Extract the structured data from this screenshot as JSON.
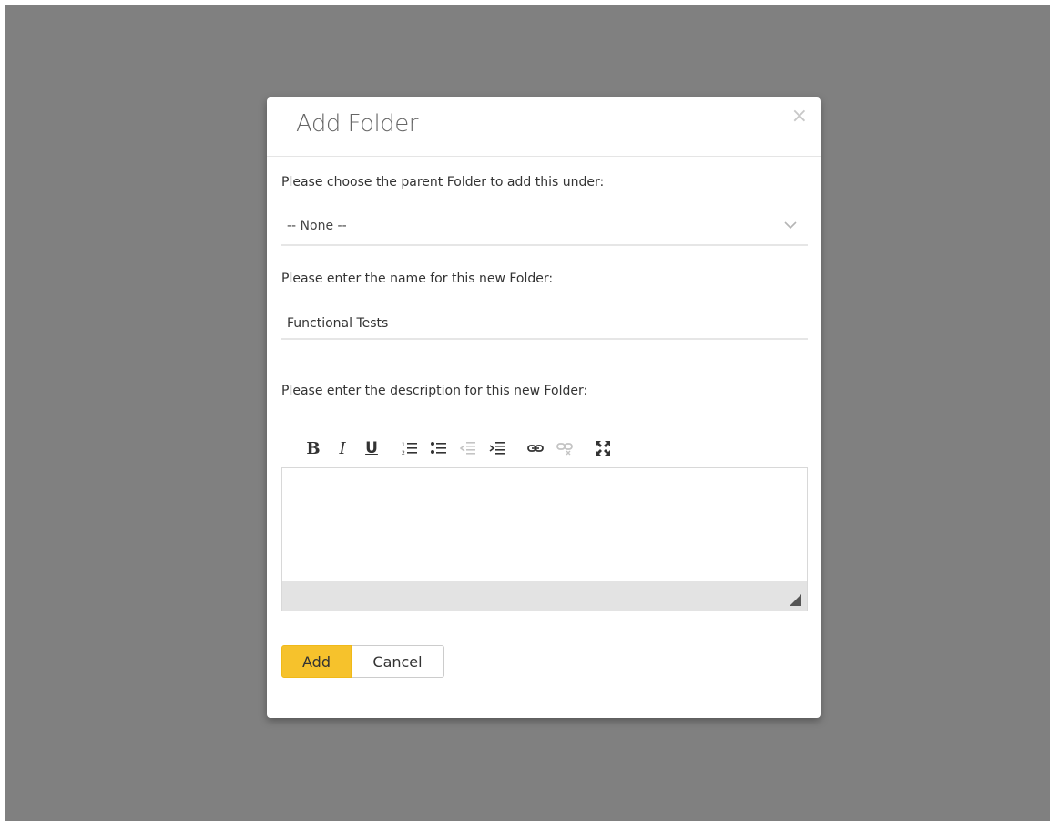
{
  "dialog": {
    "title": "Add Folder",
    "close_symbol": "×",
    "parent_label": "Please choose the parent Folder to add this under:",
    "parent_selected": "-- None --",
    "name_label": "Please enter the name for this new Folder:",
    "name_value": "Functional Tests",
    "description_label": "Please enter the description for this new Folder:",
    "description_value": "",
    "toolbar": [
      {
        "name": "bold-icon",
        "glyph": "B"
      },
      {
        "name": "italic-icon",
        "glyph": "I"
      },
      {
        "name": "underline-icon",
        "glyph": "U"
      },
      {
        "name": "numbered-list-icon"
      },
      {
        "name": "bullet-list-icon"
      },
      {
        "name": "outdent-icon",
        "disabled": true
      },
      {
        "name": "indent-icon"
      },
      {
        "name": "link-icon"
      },
      {
        "name": "unlink-icon",
        "disabled": true
      },
      {
        "name": "maximize-icon"
      }
    ],
    "add_label": "Add",
    "cancel_label": "Cancel"
  },
  "colors": {
    "overlay": "#808080",
    "primary_button": "#f6c22c",
    "statusbar": "#e3e3e3"
  }
}
